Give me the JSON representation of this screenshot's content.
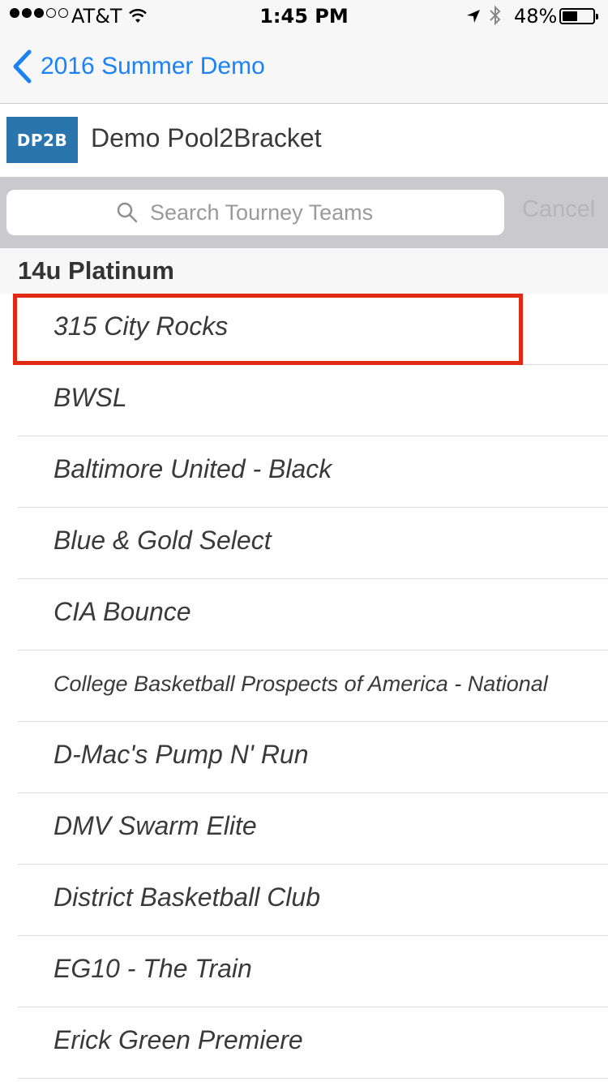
{
  "status_bar": {
    "carrier": "AT&T",
    "time": "1:45 PM",
    "battery_percent": "48%",
    "battery_level": 0.48,
    "signal_bars_filled": 3,
    "signal_bars_total": 5
  },
  "nav": {
    "back_label": "2016 Summer Demo"
  },
  "app": {
    "logo_text": "DP2B",
    "title": "Demo Pool2Bracket",
    "logo_color": "#2a75ae"
  },
  "search": {
    "placeholder": "Search Tourney Teams",
    "value": "",
    "cancel_label": "Cancel"
  },
  "section": {
    "title": "14u Platinum"
  },
  "teams": [
    "315 City Rocks",
    "BWSL",
    "Baltimore United - Black",
    "Blue & Gold Select",
    "CIA Bounce",
    "College Basketball Prospects of America - National",
    "D-Mac's Pump N' Run",
    "DMV Swarm Elite",
    "District Basketball Club",
    "EG10 - The Train",
    "Erick Green Premiere"
  ],
  "highlight_color": "#e02a14",
  "accent_color": "#1a82f5"
}
